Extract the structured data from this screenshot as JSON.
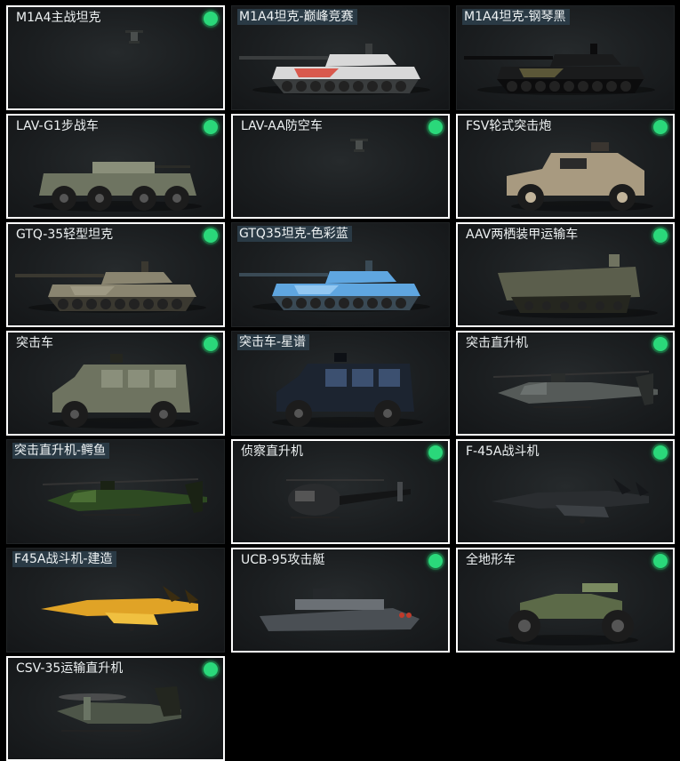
{
  "vehicles": [
    {
      "name": "M1A4主战坦克",
      "selected": true,
      "owned": true,
      "art": "drone-icon",
      "palette": {
        "body": "#4a4e4d",
        "accent": "#4a4e4d",
        "shade": "#2f3231"
      }
    },
    {
      "name": "M1A4坦克-巅峰竞赛",
      "selected": false,
      "owned": false,
      "art": "tank-icon",
      "palette": {
        "body": "#d8d8d8",
        "accent": "#d93a2b",
        "shade": "#3a3d3e"
      }
    },
    {
      "name": "M1A4坦克-钢琴黑",
      "selected": false,
      "owned": false,
      "art": "tank-icon",
      "palette": {
        "body": "#1a1b1c",
        "accent": "#6b6640",
        "shade": "#0c0c0d"
      }
    },
    {
      "name": "LAV-G1步战车",
      "selected": true,
      "owned": true,
      "art": "apc-wheeled-icon",
      "palette": {
        "body": "#6e7461",
        "accent": "#8a8f7a",
        "shade": "#2a2b27"
      }
    },
    {
      "name": "LAV-AA防空车",
      "selected": true,
      "owned": true,
      "art": "drone-icon",
      "palette": {
        "body": "#4a4e4d",
        "accent": "#4a4e4d",
        "shade": "#2f3231"
      }
    },
    {
      "name": "FSV轮式突击炮",
      "selected": true,
      "owned": true,
      "art": "armored-car-icon",
      "palette": {
        "body": "#a89a80",
        "accent": "#c2b49a",
        "shade": "#3a3530"
      }
    },
    {
      "name": "GTQ-35轻型坦克",
      "selected": true,
      "owned": true,
      "art": "tank-icon",
      "palette": {
        "body": "#8a8570",
        "accent": "#a39e88",
        "shade": "#3a3830"
      }
    },
    {
      "name": "GTQ35坦克-色彩蓝",
      "selected": false,
      "owned": false,
      "art": "tank-icon",
      "palette": {
        "body": "#5fa6e0",
        "accent": "#9fd0f5",
        "shade": "#3a4a55"
      }
    },
    {
      "name": "AAV两栖装甲运输车",
      "selected": true,
      "owned": true,
      "art": "amphibious-icon",
      "palette": {
        "body": "#5b5e4c",
        "accent": "#707360",
        "shade": "#25261f"
      }
    },
    {
      "name": "突击车",
      "selected": true,
      "owned": true,
      "art": "mrap-icon",
      "palette": {
        "body": "#6e7360",
        "accent": "#8a8f7b",
        "shade": "#25261f"
      }
    },
    {
      "name": "突击车-星谱",
      "selected": false,
      "owned": false,
      "art": "mrap-icon",
      "palette": {
        "body": "#1c2430",
        "accent": "#3c5070",
        "shade": "#0d1015"
      }
    },
    {
      "name": "突击直升机",
      "selected": true,
      "owned": true,
      "art": "attack-heli-icon",
      "palette": {
        "body": "#555a58",
        "accent": "#6b716f",
        "shade": "#2a2d2c"
      }
    },
    {
      "name": "突击直升机-鳄鱼",
      "selected": false,
      "owned": false,
      "art": "attack-heli-icon",
      "palette": {
        "body": "#2e4a22",
        "accent": "#4a6e34",
        "shade": "#1a2214"
      }
    },
    {
      "name": "侦察直升机",
      "selected": true,
      "owned": true,
      "art": "scout-heli-icon",
      "palette": {
        "body": "#2a2c2e",
        "accent": "#45484b",
        "shade": "#141516"
      }
    },
    {
      "name": "F-45A战斗机",
      "selected": true,
      "owned": true,
      "art": "jet-icon",
      "palette": {
        "body": "#2a2d30",
        "accent": "#3c4044",
        "shade": "#15171a"
      }
    },
    {
      "name": "F45A战斗机-建造",
      "selected": false,
      "owned": false,
      "art": "jet-icon",
      "palette": {
        "body": "#e0a326",
        "accent": "#f0c040",
        "shade": "#3a2c10"
      }
    },
    {
      "name": "UCB-95攻击艇",
      "selected": true,
      "owned": true,
      "art": "boat-icon",
      "palette": {
        "body": "#4a4f54",
        "accent": "#6b7075",
        "shade": "#25282b"
      }
    },
    {
      "name": "全地形车",
      "selected": true,
      "owned": true,
      "art": "atv-icon",
      "palette": {
        "body": "#5c6a48",
        "accent": "#7a8a60",
        "shade": "#1e1f1c"
      }
    },
    {
      "name": "CSV-35运输直升机",
      "selected": true,
      "owned": true,
      "art": "tiltrotor-icon",
      "palette": {
        "body": "#4d5548",
        "accent": "#6a7464",
        "shade": "#23261f"
      }
    }
  ]
}
